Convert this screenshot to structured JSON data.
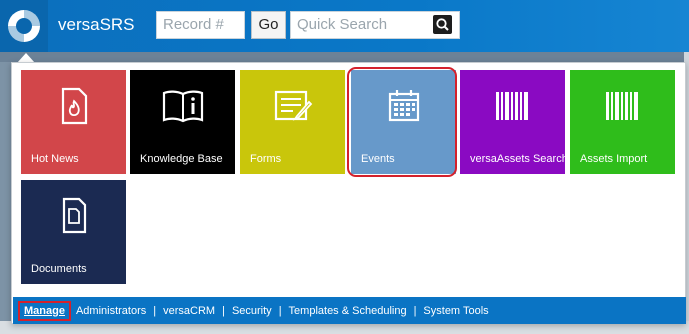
{
  "header": {
    "app_title": "versaSRS",
    "record_placeholder": "Record #",
    "go_label": "Go",
    "search_placeholder": "Quick Search"
  },
  "tiles": [
    {
      "label": "Hot News",
      "color": "#d2464a",
      "icon": "fire-document-icon"
    },
    {
      "label": "Knowledge Base",
      "color": "#000000",
      "icon": "book-info-icon"
    },
    {
      "label": "Forms",
      "color": "#c9c60b",
      "icon": "form-icon"
    },
    {
      "label": "Events",
      "color": "#6799ca",
      "icon": "calendar-icon"
    },
    {
      "label": "versaAssets Search",
      "color": "#8a0ac2",
      "icon": "barcode-icon"
    },
    {
      "label": "Assets Import",
      "color": "#2fbd1b",
      "icon": "barcode-icon"
    },
    {
      "label": "Documents",
      "color": "#1b2a52",
      "icon": "document-icon"
    }
  ],
  "footer": {
    "links": [
      "Manage",
      "Administrators",
      "versaCRM",
      "Security",
      "Templates & Scheduling",
      "System Tools"
    ]
  },
  "colors": {
    "brand": "#0a74c4",
    "highlight": "#d4212c"
  }
}
